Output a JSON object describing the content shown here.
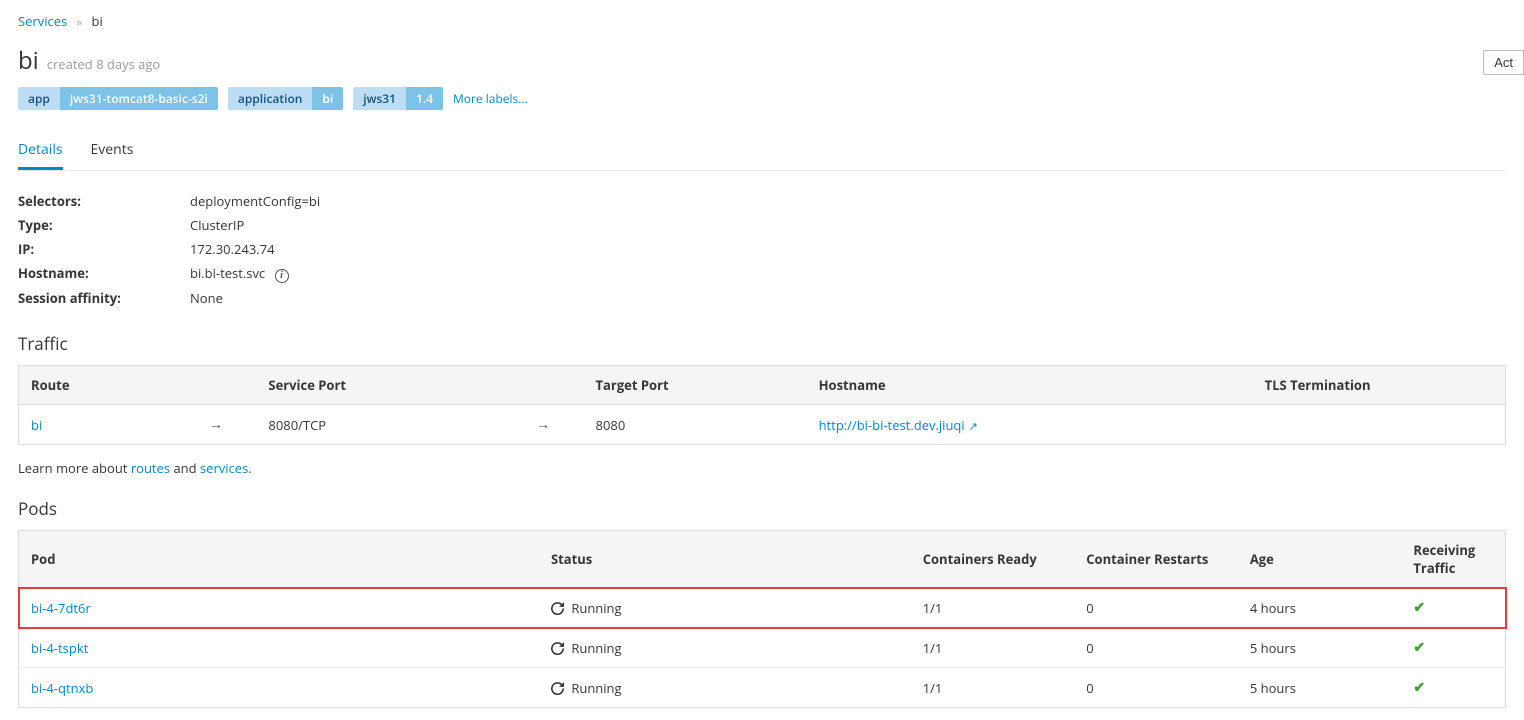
{
  "breadcrumb": {
    "root": "Services",
    "current": "bi"
  },
  "title": "bi",
  "title_meta": "created 8 days ago",
  "actions_label": "Act",
  "labels": [
    {
      "k": "app",
      "v": "jws31-tomcat8-basic-s2i"
    },
    {
      "k": "application",
      "v": "bi"
    },
    {
      "k": "jws31",
      "v": "1.4"
    }
  ],
  "more_labels": "More labels...",
  "tabs": {
    "details": "Details",
    "events": "Events"
  },
  "details": {
    "selectors_label": "Selectors:",
    "selectors_value": "deploymentConfig=bi",
    "type_label": "Type:",
    "type_value": "ClusterIP",
    "ip_label": "IP:",
    "ip_value": "172.30.243.74",
    "hostname_label": "Hostname:",
    "hostname_value": "bi.bi-test.svc",
    "affinity_label": "Session affinity:",
    "affinity_value": "None"
  },
  "traffic": {
    "heading": "Traffic",
    "headers": {
      "route": "Route",
      "service_port": "Service Port",
      "target_port": "Target Port",
      "hostname": "Hostname",
      "tls": "TLS Termination"
    },
    "rows": [
      {
        "route": "bi",
        "service_port": "8080/TCP",
        "target_port": "8080",
        "hostname": "http://bi-bi-test.dev.jiuqi",
        "tls": ""
      }
    ],
    "learn_pre": "Learn more about ",
    "learn_routes": "routes",
    "learn_mid": " and ",
    "learn_services": "services",
    "learn_post": "."
  },
  "pods": {
    "heading": "Pods",
    "headers": {
      "pod": "Pod",
      "status": "Status",
      "ready": "Containers Ready",
      "restarts": "Container Restarts",
      "age": "Age",
      "receiving": "Receiving Traffic"
    },
    "rows": [
      {
        "pod": "bi-4-7dt6r",
        "status": "Running",
        "ready": "1/1",
        "restarts": "0",
        "age": "4 hours",
        "highlight": true
      },
      {
        "pod": "bi-4-tspkt",
        "status": "Running",
        "ready": "1/1",
        "restarts": "0",
        "age": "5 hours",
        "highlight": false
      },
      {
        "pod": "bi-4-qtnxb",
        "status": "Running",
        "ready": "1/1",
        "restarts": "0",
        "age": "5 hours",
        "highlight": false
      }
    ]
  }
}
